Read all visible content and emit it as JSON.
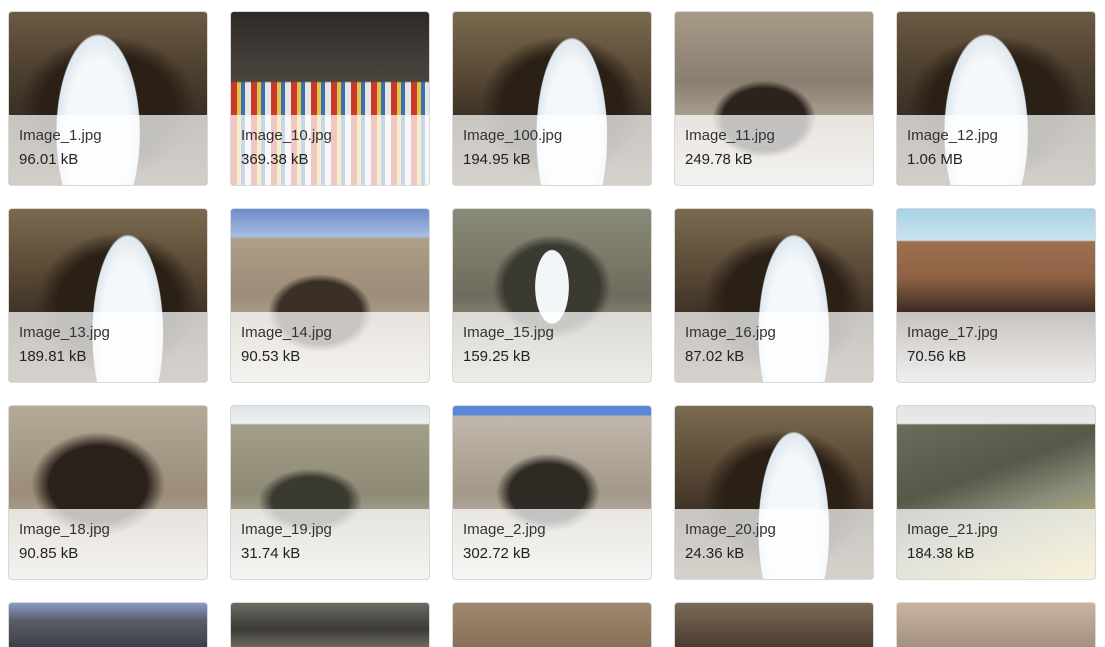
{
  "tiles": [
    {
      "name": "Image_1.jpg",
      "size": "96.01 kB",
      "thumb": "cave-ice"
    },
    {
      "name": "Image_10.jpg",
      "size": "369.38 kB",
      "thumb": "crowd"
    },
    {
      "name": "Image_100.jpg",
      "size": "194.95 kB",
      "thumb": "cave-ice ice-right"
    },
    {
      "name": "Image_11.jpg",
      "size": "249.78 kB",
      "thumb": "rock-cave"
    },
    {
      "name": "Image_12.jpg",
      "size": "1.06 MB",
      "thumb": "cave-ice"
    },
    {
      "name": "Image_13.jpg",
      "size": "189.81 kB",
      "thumb": "cave-ice ice-right"
    },
    {
      "name": "Image_14.jpg",
      "size": "90.53 kB",
      "thumb": "rock-sky"
    },
    {
      "name": "Image_15.jpg",
      "size": "159.25 kB",
      "thumb": "cave-shrine"
    },
    {
      "name": "Image_16.jpg",
      "size": "87.02 kB",
      "thumb": "cave-ice ice-right"
    },
    {
      "name": "Image_17.jpg",
      "size": "70.56 kB",
      "thumb": "cliff-sky"
    },
    {
      "name": "Image_18.jpg",
      "size": "90.85 kB",
      "thumb": "dark-rock"
    },
    {
      "name": "Image_19.jpg",
      "size": "31.74 kB",
      "thumb": "grey-rock"
    },
    {
      "name": "Image_2.jpg",
      "size": "302.72 kB",
      "thumb": "blue-sky-rock"
    },
    {
      "name": "Image_20.jpg",
      "size": "24.36 kB",
      "thumb": "cave-ice ice-right"
    },
    {
      "name": "Image_21.jpg",
      "size": "184.38 kB",
      "thumb": "valley"
    }
  ],
  "partial_row": [
    "partial-a",
    "partial-b",
    "partial-c",
    "partial-d",
    "partial-e"
  ]
}
